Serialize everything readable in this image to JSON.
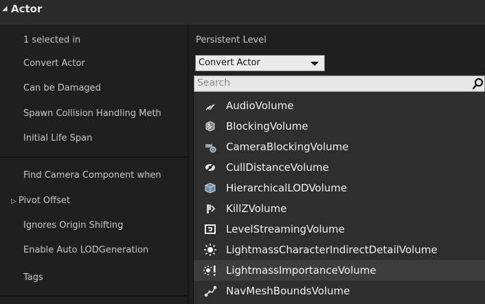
{
  "section": {
    "toggle_icon": "triangle-down-icon",
    "title": "Actor"
  },
  "rows": [
    {
      "label": "1 selected in"
    },
    {
      "label": "Convert Actor"
    },
    {
      "label": "Can be Damaged"
    },
    {
      "label": "Spawn Collision Handling Meth"
    },
    {
      "label": "Initial Life Span"
    },
    {
      "label": "Find Camera Component when"
    },
    {
      "label": "Pivot Offset",
      "expand": "triangle-right-icon"
    },
    {
      "label": "Ignores Origin Shifting"
    },
    {
      "label": "Enable Auto LODGeneration"
    },
    {
      "label": "Tags"
    }
  ],
  "value": {
    "persistent_level": "Persistent Level",
    "convert_combo": "Convert Actor"
  },
  "popup": {
    "search_placeholder": "Search",
    "items": [
      {
        "label": "AudioVolume",
        "icon": "audio-volume-icon"
      },
      {
        "label": "BlockingVolume",
        "icon": "blocking-volume-icon"
      },
      {
        "label": "CameraBlockingVolume",
        "icon": "camera-blocking-volume-icon"
      },
      {
        "label": "CullDistanceVolume",
        "icon": "cull-distance-volume-icon"
      },
      {
        "label": "HierarchicalLODVolume",
        "icon": "hierarchical-lod-volume-icon"
      },
      {
        "label": "KillZVolume",
        "icon": "killz-volume-icon"
      },
      {
        "label": "LevelStreamingVolume",
        "icon": "level-streaming-volume-icon"
      },
      {
        "label": "LightmassCharacterIndirectDetailVolume",
        "icon": "lightmass-character-volume-icon"
      },
      {
        "label": "LightmassImportanceVolume",
        "icon": "lightmass-importance-volume-icon"
      },
      {
        "label": "NavMeshBoundsVolume",
        "icon": "navmesh-bounds-volume-icon"
      }
    ],
    "highlighted_index": 8
  },
  "colors": {
    "background": "#1f1f1f",
    "header": "#2a2a2a",
    "popup": "#2e2e2e",
    "highlight": "#3d3d3d"
  }
}
